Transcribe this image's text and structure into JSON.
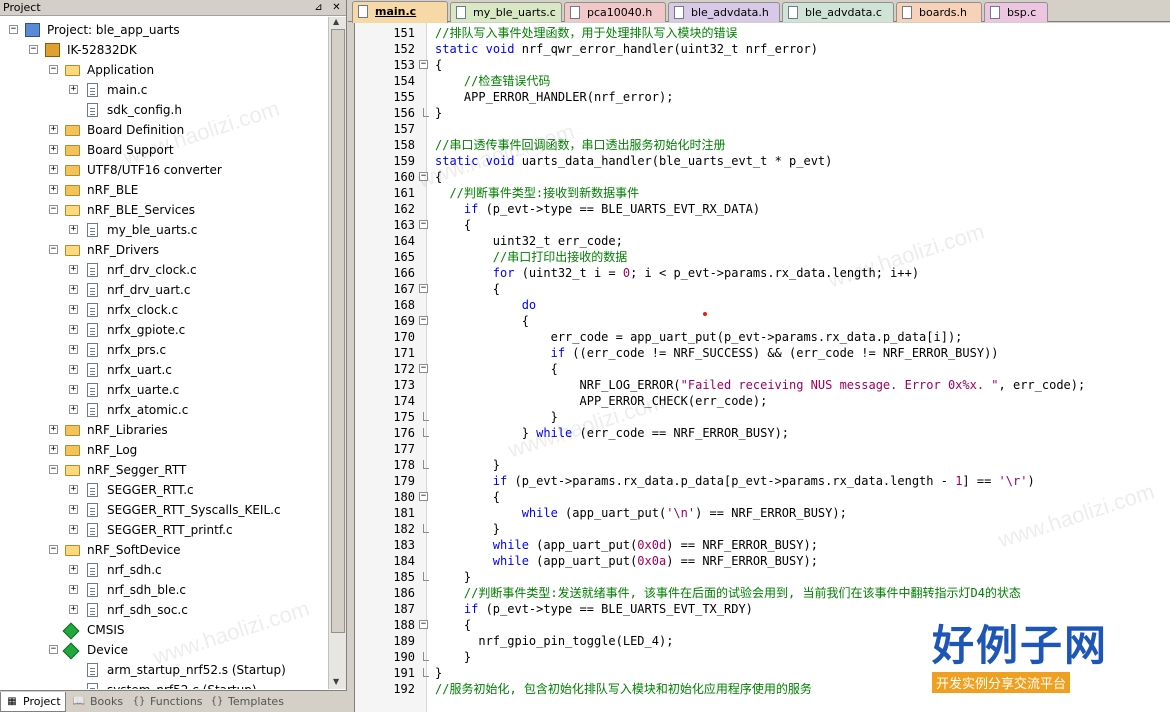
{
  "project_panel": {
    "title": "Project",
    "pin_icon": "pin-icon",
    "close_icon": "close-icon",
    "tree": [
      {
        "label": "Project: ble_app_uarts",
        "level": 0,
        "type": "project",
        "expander": "minus"
      },
      {
        "label": "IK-52832DK",
        "level": 1,
        "type": "target",
        "expander": "minus"
      },
      {
        "label": "Application",
        "level": 2,
        "type": "folder-open",
        "expander": "minus"
      },
      {
        "label": "main.c",
        "level": 3,
        "type": "file",
        "expander": "plus"
      },
      {
        "label": "sdk_config.h",
        "level": 3,
        "type": "file",
        "expander": "none"
      },
      {
        "label": "Board Definition",
        "level": 2,
        "type": "folder",
        "expander": "plus"
      },
      {
        "label": "Board Support",
        "level": 2,
        "type": "folder",
        "expander": "plus"
      },
      {
        "label": "UTF8/UTF16 converter",
        "level": 2,
        "type": "folder",
        "expander": "plus"
      },
      {
        "label": "nRF_BLE",
        "level": 2,
        "type": "folder",
        "expander": "plus"
      },
      {
        "label": "nRF_BLE_Services",
        "level": 2,
        "type": "folder-open",
        "expander": "minus"
      },
      {
        "label": "my_ble_uarts.c",
        "level": 3,
        "type": "file",
        "expander": "plus"
      },
      {
        "label": "nRF_Drivers",
        "level": 2,
        "type": "folder-open",
        "expander": "minus"
      },
      {
        "label": "nrf_drv_clock.c",
        "level": 3,
        "type": "file",
        "expander": "plus"
      },
      {
        "label": "nrf_drv_uart.c",
        "level": 3,
        "type": "file",
        "expander": "plus"
      },
      {
        "label": "nrfx_clock.c",
        "level": 3,
        "type": "file",
        "expander": "plus"
      },
      {
        "label": "nrfx_gpiote.c",
        "level": 3,
        "type": "file",
        "expander": "plus"
      },
      {
        "label": "nrfx_prs.c",
        "level": 3,
        "type": "file",
        "expander": "plus"
      },
      {
        "label": "nrfx_uart.c",
        "level": 3,
        "type": "file",
        "expander": "plus"
      },
      {
        "label": "nrfx_uarte.c",
        "level": 3,
        "type": "file",
        "expander": "plus"
      },
      {
        "label": "nrfx_atomic.c",
        "level": 3,
        "type": "file",
        "expander": "plus"
      },
      {
        "label": "nRF_Libraries",
        "level": 2,
        "type": "folder",
        "expander": "plus"
      },
      {
        "label": "nRF_Log",
        "level": 2,
        "type": "folder",
        "expander": "plus"
      },
      {
        "label": "nRF_Segger_RTT",
        "level": 2,
        "type": "folder-open",
        "expander": "minus"
      },
      {
        "label": "SEGGER_RTT.c",
        "level": 3,
        "type": "file",
        "expander": "plus"
      },
      {
        "label": "SEGGER_RTT_Syscalls_KEIL.c",
        "level": 3,
        "type": "file",
        "expander": "plus"
      },
      {
        "label": "SEGGER_RTT_printf.c",
        "level": 3,
        "type": "file",
        "expander": "plus"
      },
      {
        "label": "nRF_SoftDevice",
        "level": 2,
        "type": "folder-open",
        "expander": "minus"
      },
      {
        "label": "nrf_sdh.c",
        "level": 3,
        "type": "file",
        "expander": "plus"
      },
      {
        "label": "nrf_sdh_ble.c",
        "level": 3,
        "type": "file",
        "expander": "plus"
      },
      {
        "label": "nrf_sdh_soc.c",
        "level": 3,
        "type": "file",
        "expander": "plus"
      },
      {
        "label": "CMSIS",
        "level": 2,
        "type": "component",
        "expander": "none"
      },
      {
        "label": "Device",
        "level": 2,
        "type": "component",
        "expander": "minus"
      },
      {
        "label": "arm_startup_nrf52.s (Startup)",
        "level": 3,
        "type": "file",
        "expander": "none"
      },
      {
        "label": "system_nrf52.c (Startup)",
        "level": 3,
        "type": "file",
        "expander": "none"
      }
    ],
    "bottom_tabs": [
      {
        "label": "Project",
        "icon": "project-icon",
        "active": true
      },
      {
        "label": "Books",
        "icon": "books-icon",
        "active": false
      },
      {
        "label": "Functions",
        "icon": "functions-icon",
        "active": false
      },
      {
        "label": "Templates",
        "icon": "templates-icon",
        "active": false
      }
    ]
  },
  "editor": {
    "tabs": [
      {
        "label": "main.c",
        "color": "#f7d9a8",
        "active": true
      },
      {
        "label": "my_ble_uarts.c",
        "color": "#d9e8c4",
        "active": false
      },
      {
        "label": "pca10040.h",
        "color": "#f2c7c7",
        "active": false
      },
      {
        "label": "ble_advdata.h",
        "color": "#d8c9e8",
        "active": false
      },
      {
        "label": "ble_advdata.c",
        "color": "#cfe3d6",
        "active": false
      },
      {
        "label": "boards.h",
        "color": "#f7d2b8",
        "active": false
      },
      {
        "label": "bsp.c",
        "color": "#ecc6e0",
        "active": false
      }
    ],
    "lines": [
      {
        "n": "151",
        "fold": "",
        "cls": "cm",
        "text": "//排队写入事件处理函数，用于处理排队写入模块的错误"
      },
      {
        "n": "152",
        "fold": "",
        "cls": "",
        "text": "static void nrf_qwr_error_handler(uint32_t nrf_error)"
      },
      {
        "n": "153",
        "fold": "minus",
        "cls": "",
        "text": "{"
      },
      {
        "n": "154",
        "fold": "",
        "cls": "cm",
        "text": "    //检查错误代码"
      },
      {
        "n": "155",
        "fold": "",
        "cls": "",
        "text": "    APP_ERROR_HANDLER(nrf_error);"
      },
      {
        "n": "156",
        "fold": "end",
        "cls": "",
        "text": "}"
      },
      {
        "n": "157",
        "fold": "",
        "cls": "",
        "text": ""
      },
      {
        "n": "158",
        "fold": "",
        "cls": "cm",
        "text": "//串口透传事件回调函数，串口透出服务初始化时注册"
      },
      {
        "n": "159",
        "fold": "",
        "cls": "",
        "text": "static void uarts_data_handler(ble_uarts_evt_t * p_evt)"
      },
      {
        "n": "160",
        "fold": "minus",
        "cls": "",
        "text": "{"
      },
      {
        "n": "161",
        "fold": "",
        "cls": "cm",
        "text": "  //判断事件类型:接收到新数据事件"
      },
      {
        "n": "162",
        "fold": "",
        "cls": "",
        "text": "    if (p_evt->type == BLE_UARTS_EVT_RX_DATA)"
      },
      {
        "n": "163",
        "fold": "minus",
        "cls": "",
        "text": "    {"
      },
      {
        "n": "164",
        "fold": "",
        "cls": "",
        "text": "        uint32_t err_code;"
      },
      {
        "n": "165",
        "fold": "",
        "cls": "cm",
        "text": "        //串口打印出接收的数据"
      },
      {
        "n": "166",
        "fold": "",
        "cls": "",
        "text": "        for (uint32_t i = 0; i < p_evt->params.rx_data.length; i++)"
      },
      {
        "n": "167",
        "fold": "minus",
        "cls": "",
        "text": "        {"
      },
      {
        "n": "168",
        "fold": "",
        "cls": "",
        "text": "            do"
      },
      {
        "n": "169",
        "fold": "minus",
        "cls": "",
        "text": "            {"
      },
      {
        "n": "170",
        "fold": "",
        "cls": "",
        "text": "                err_code = app_uart_put(p_evt->params.rx_data.p_data[i]);"
      },
      {
        "n": "171",
        "fold": "",
        "cls": "",
        "text": "                if ((err_code != NRF_SUCCESS) && (err_code != NRF_ERROR_BUSY))"
      },
      {
        "n": "172",
        "fold": "minus",
        "cls": "",
        "text": "                {"
      },
      {
        "n": "173",
        "fold": "",
        "cls": "",
        "text": "                    NRF_LOG_ERROR(\"Failed receiving NUS message. Error 0x%x. \", err_code);"
      },
      {
        "n": "174",
        "fold": "",
        "cls": "",
        "text": "                    APP_ERROR_CHECK(err_code);"
      },
      {
        "n": "175",
        "fold": "end",
        "cls": "",
        "text": "                }"
      },
      {
        "n": "176",
        "fold": "end",
        "cls": "",
        "text": "            } while (err_code == NRF_ERROR_BUSY);"
      },
      {
        "n": "177",
        "fold": "",
        "cls": "",
        "text": ""
      },
      {
        "n": "178",
        "fold": "end",
        "cls": "",
        "text": "        }"
      },
      {
        "n": "179",
        "fold": "",
        "cls": "",
        "text": "        if (p_evt->params.rx_data.p_data[p_evt->params.rx_data.length - 1] == '\\r')"
      },
      {
        "n": "180",
        "fold": "minus",
        "cls": "",
        "text": "        {"
      },
      {
        "n": "181",
        "fold": "",
        "cls": "",
        "text": "            while (app_uart_put('\\n') == NRF_ERROR_BUSY);"
      },
      {
        "n": "182",
        "fold": "end",
        "cls": "",
        "text": "        }"
      },
      {
        "n": "183",
        "fold": "",
        "cls": "",
        "text": "        while (app_uart_put(0x0d) == NRF_ERROR_BUSY);"
      },
      {
        "n": "184",
        "fold": "",
        "cls": "",
        "text": "        while (app_uart_put(0x0a) == NRF_ERROR_BUSY);"
      },
      {
        "n": "185",
        "fold": "end",
        "cls": "",
        "text": "    }"
      },
      {
        "n": "186",
        "fold": "",
        "cls": "cm",
        "text": "    //判断事件类型:发送就绪事件, 该事件在后面的试验会用到, 当前我们在该事件中翻转指示灯D4的状态"
      },
      {
        "n": "187",
        "fold": "",
        "cls": "",
        "text": "    if (p_evt->type == BLE_UARTS_EVT_TX_RDY)"
      },
      {
        "n": "188",
        "fold": "minus",
        "cls": "",
        "text": "    {"
      },
      {
        "n": "189",
        "fold": "",
        "cls": "",
        "text": "      nrf_gpio_pin_toggle(LED_4);"
      },
      {
        "n": "190",
        "fold": "end",
        "cls": "",
        "text": "    }"
      },
      {
        "n": "191",
        "fold": "end",
        "cls": "",
        "text": "}"
      },
      {
        "n": "192",
        "fold": "",
        "cls": "cm",
        "text": "//服务初始化, 包含初始化排队写入模块和初始化应用程序使用的服务"
      }
    ]
  },
  "watermark": {
    "text": "www.haolizi.com",
    "brand_big": "好例子网",
    "brand_small": "开发实例分享交流平台"
  }
}
